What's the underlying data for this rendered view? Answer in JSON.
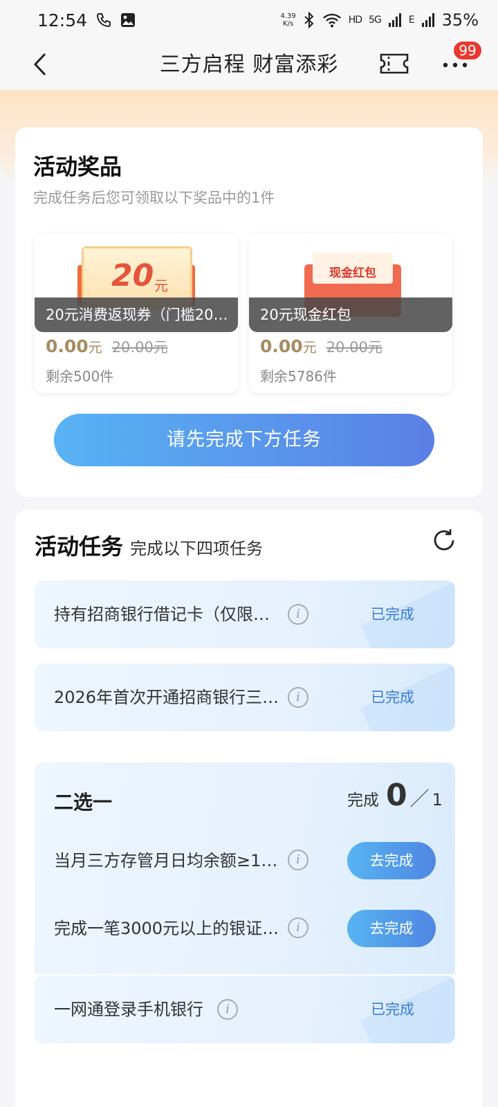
{
  "status_bar": {
    "time": "12:54",
    "net_speed_value": "4.39",
    "net_speed_unit": "K/s",
    "hd_label": "HD",
    "signal_5g": "5G",
    "signal_e": "E",
    "battery": "35%"
  },
  "nav": {
    "title": "三方启程 财富添彩",
    "badge_count": "99"
  },
  "prizes": {
    "title": "活动奖品",
    "subtitle": "完成任务后您可领取以下奖品中的1件",
    "items": [
      {
        "art_number": "20",
        "art_unit": "元",
        "name": "20元消费返现券（门槛20…",
        "price_now": "0.00",
        "price_unit": "元",
        "price_old": "20.00元",
        "remaining": "剩余500件"
      },
      {
        "art_text": "现金红包",
        "name": "20元现金红包",
        "price_now": "0.00",
        "price_unit": "元",
        "price_old": "20.00元",
        "remaining": "剩余5786件"
      }
    ],
    "button_label": "请先完成下方任务"
  },
  "tasks": {
    "title": "活动任务",
    "subtitle": "完成以下四项任务",
    "items": [
      {
        "text": "持有招商银行借记卡（仅限…",
        "status": "已完成"
      },
      {
        "text": "2026年首次开通招商银行三…",
        "status": "已完成"
      },
      {
        "text": "一网通登录手机银行",
        "status": "已完成"
      }
    ],
    "choose": {
      "title": "二选一",
      "progress_label": "完成",
      "progress_done": "0",
      "progress_sep": "／",
      "progress_total": "1",
      "options": [
        {
          "text": "当月三方存管月日均余额≥1…",
          "button": "去完成"
        },
        {
          "text": "完成一笔3000元以上的银证…",
          "button": "去完成"
        }
      ]
    }
  },
  "icons": {
    "back": "chevron-left-icon",
    "ticket": "ticket-icon",
    "more": "more-dots-icon",
    "refresh": "refresh-icon",
    "info": "info-icon"
  },
  "colors": {
    "accent_blue": "#3a7bd5",
    "badge_red": "#e8392f",
    "price_gold": "#a88b62"
  }
}
